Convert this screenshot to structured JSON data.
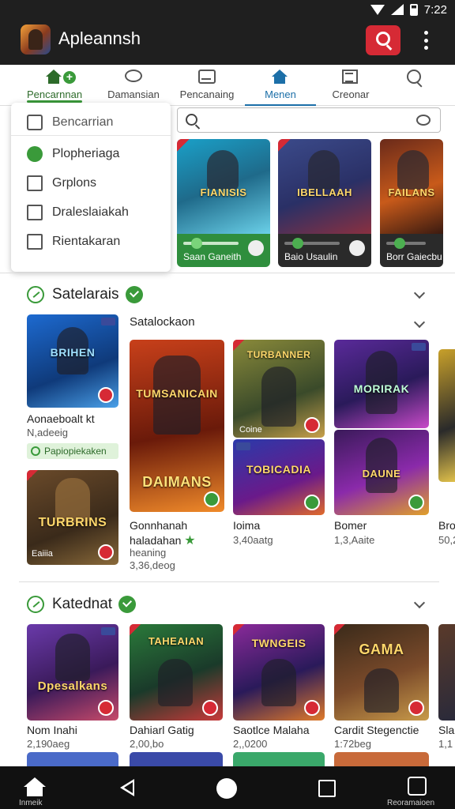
{
  "status_bar": {
    "time": "7:22"
  },
  "app_bar": {
    "title": "Apleannsh"
  },
  "tabs": [
    {
      "label": "Pencarnnan",
      "icon": "home-plus-icon"
    },
    {
      "label": "Damansian",
      "icon": "chat-bubble-icon"
    },
    {
      "label": "Pencanaing",
      "icon": "card-icon"
    },
    {
      "label": "Menen",
      "icon": "home-icon",
      "active": true
    },
    {
      "label": "Creonar",
      "icon": "newspaper-icon"
    },
    {
      "label": "",
      "icon": "search-icon"
    }
  ],
  "dropdown": {
    "header": "Bencarrian",
    "items": [
      "Plopheriaga",
      "Grplons",
      "Draleslaiakah",
      "Rientakaran"
    ]
  },
  "search": {
    "placeholder": ""
  },
  "featured": [
    {
      "title": "FIANISIS",
      "label": "Saan Ganeith"
    },
    {
      "title": "IBELLAAH",
      "label": "Baio Usaulin"
    },
    {
      "title": "FAILANS",
      "label": "Borr Gaiecbu"
    }
  ],
  "section1": {
    "title": "Satelarais",
    "subtitle": "Satalockaon",
    "items": [
      {
        "title": "BRIHEN",
        "name": "Aonaeboalt kt",
        "meta": "N,adeeig",
        "tag": "Papiopiekaken"
      },
      {
        "title": "TURBRINS",
        "name": "",
        "meta": "Eaiiia"
      },
      {
        "title": "TUMSANICAIN",
        "name": "Gonnhanah",
        "name2": "haladahan",
        "meta": "heaning",
        "meta2": "3,36,deog",
        "poster": "DAIMANS"
      },
      {
        "title": "TURBANNER",
        "name": "Ioima",
        "meta": "3,40aatg",
        "tag": "Coine"
      },
      {
        "title": "TOBICADIA",
        "name": "",
        "meta": ""
      },
      {
        "title": "MORIRAK",
        "name": "Bomer",
        "meta": "1,3,Aaite"
      },
      {
        "title": "DAUNE",
        "name": "",
        "meta": ""
      },
      {
        "title": "",
        "name": "Bro",
        "meta": "50,2"
      }
    ]
  },
  "section2": {
    "title": "Katednat",
    "items": [
      {
        "title": "Dpesalkans",
        "name": "Nom Inahi",
        "meta": "2,190aeg"
      },
      {
        "title": "TAHEAIAN",
        "name": "Dahiarl Gatig",
        "meta": "2,00,bo"
      },
      {
        "title": "TWNGEIS",
        "name": "Saotlce Malaha",
        "meta": "2,,0200"
      },
      {
        "title": "GAMA",
        "name": "Cardit Stegenctie",
        "meta": "1:72beg"
      },
      {
        "title": "",
        "name": "Sla",
        "meta": "1,1"
      }
    ]
  },
  "bottom_nav": {
    "home_label": "Inmeik",
    "right_label": "Reoramaioen"
  },
  "colors": {
    "accent_red": "#d62a35",
    "accent_green": "#3a9a3a",
    "tab_active": "#1c6fa8",
    "app_bar": "#1f1f1f"
  }
}
